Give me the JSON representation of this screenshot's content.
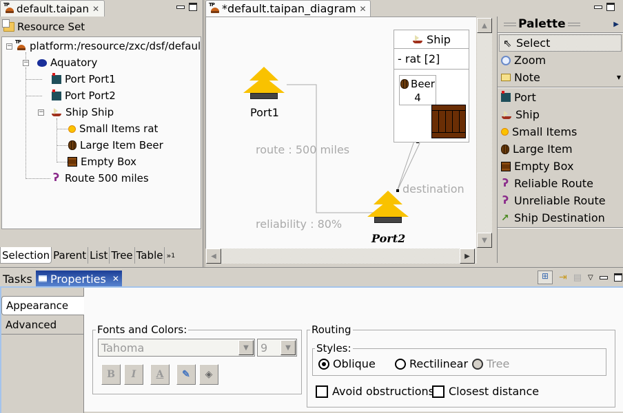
{
  "left_view": {
    "tab_title": "default.taipan",
    "root_label": "Resource Set",
    "tree": [
      {
        "label": "platform:/resource/zxc/dsf/default.taipan",
        "icon": "taipan-file-icon",
        "expanded": true
      },
      {
        "label": "Aquatory",
        "icon": "aquatory-icon",
        "expanded": true
      },
      {
        "label": "Port Port1",
        "icon": "port-icon"
      },
      {
        "label": "Port Port2",
        "icon": "port-icon"
      },
      {
        "label": "Ship Ship",
        "icon": "ship-icon",
        "expanded": true
      },
      {
        "label": "Small Items rat",
        "icon": "small-items-icon"
      },
      {
        "label": "Large Item Beer",
        "icon": "barrel-icon"
      },
      {
        "label": "Empty Box",
        "icon": "box-icon"
      },
      {
        "label": "Route 500 miles",
        "icon": "route-icon"
      }
    ],
    "bottom_tabs": [
      "Selection",
      "Parent",
      "List",
      "Tree",
      "Table"
    ],
    "overflow_label": "»",
    "overflow_count": "1"
  },
  "editor": {
    "tab_title": "*default.taipan_diagram",
    "ports": [
      {
        "label": "Port1"
      },
      {
        "label": "Port2"
      }
    ],
    "ship": {
      "title": "Ship",
      "attribute": "- rat [2]",
      "large_item": {
        "name": "Beer",
        "count": "4"
      }
    },
    "route": {
      "name_label": "route : 500 miles",
      "reliability_label": "reliability : 80%"
    },
    "destination_label": "destination"
  },
  "palette": {
    "title": "Palette",
    "tools": [
      {
        "label": "Select",
        "icon": "arrow-cursor-icon",
        "selected": true
      },
      {
        "label": "Zoom",
        "icon": "magnifier-icon"
      },
      {
        "label": "Note",
        "icon": "note-icon"
      }
    ],
    "items": [
      {
        "label": "Port",
        "icon": "port-icon"
      },
      {
        "label": "Ship",
        "icon": "ship-icon"
      },
      {
        "label": "Small Items",
        "icon": "small-items-icon"
      },
      {
        "label": "Large Item",
        "icon": "barrel-icon"
      },
      {
        "label": "Empty Box",
        "icon": "box-icon"
      },
      {
        "label": "Reliable Route",
        "icon": "route-icon"
      },
      {
        "label": "Unreliable Route",
        "icon": "route-icon"
      },
      {
        "label": "Ship Destination",
        "icon": "green-arrow-icon"
      }
    ]
  },
  "properties_view": {
    "tabs": [
      {
        "label": "Tasks",
        "active": false
      },
      {
        "label": "Properties",
        "active": true
      }
    ],
    "side_tabs": [
      "Appearance",
      "Advanced"
    ],
    "fonts_colors": {
      "legend": "Fonts and Colors:",
      "font_name": "Tahoma",
      "font_size": "9",
      "buttons": [
        "B",
        "I",
        "A",
        "pen",
        "fill"
      ]
    },
    "routing": {
      "legend": "Routing",
      "styles_legend": "Styles:",
      "styles": [
        {
          "label": "Oblique",
          "checked": true,
          "enabled": true
        },
        {
          "label": "Rectilinear",
          "checked": false,
          "enabled": true
        },
        {
          "label": "Tree",
          "checked": false,
          "enabled": false
        }
      ],
      "checkboxes": [
        {
          "label": "Avoid obstructions",
          "checked": false
        },
        {
          "label": "Closest distance",
          "checked": false
        }
      ]
    }
  },
  "colors": {
    "port_fill": "#f9c200",
    "active_tab_blue": "#1c3f96",
    "connection_gray": "#aaaaaa"
  }
}
